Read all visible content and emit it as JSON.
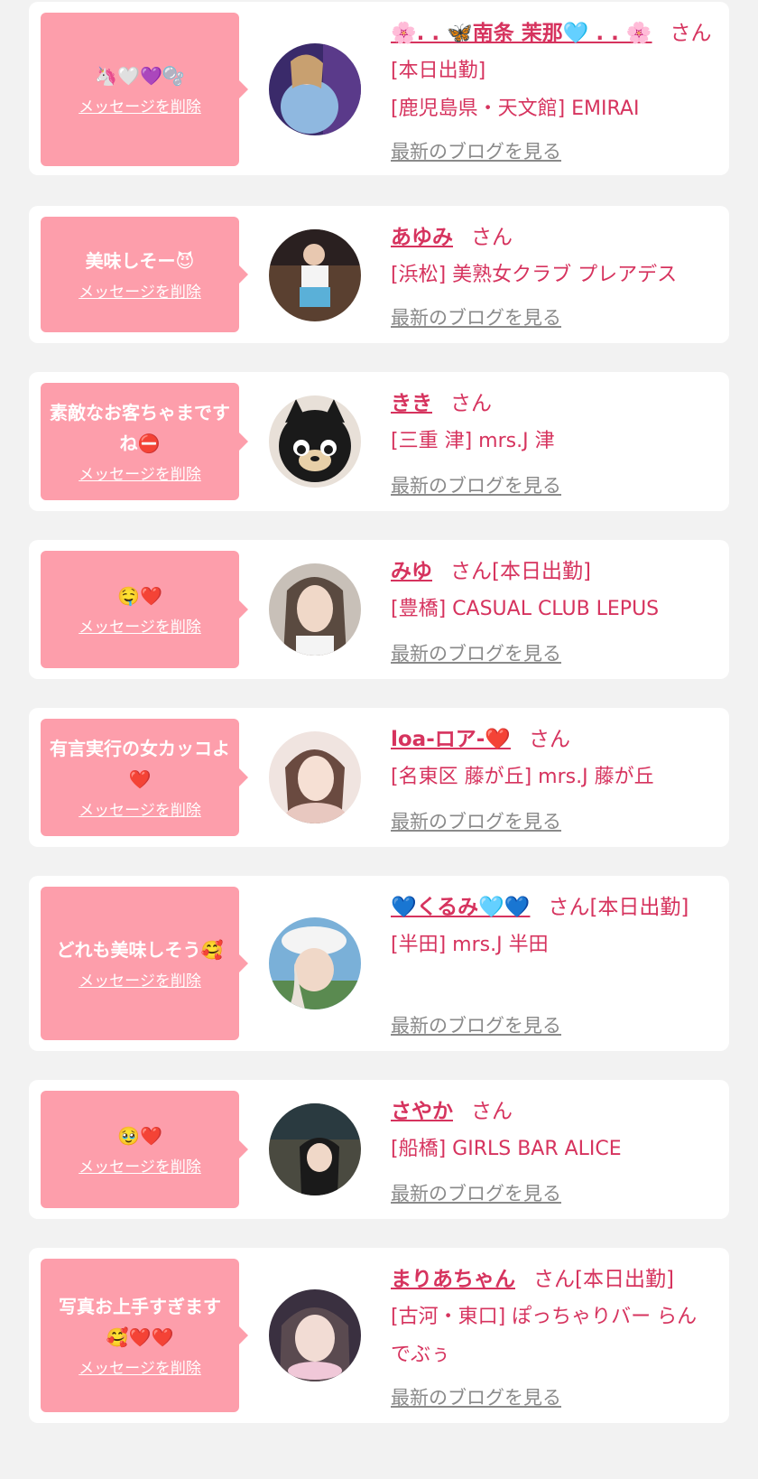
{
  "messages": [
    {
      "message": "🦄🤍💜🫧",
      "delete_label": "メッセージを削除",
      "name": "🌸. . 🦋南条 茉那🩵 . . 🌸",
      "suffix": "さん",
      "info": [
        "[本日出勤]",
        "[鹿児島県・天文館] EMIRAI"
      ],
      "blog_label": "最新のブログを見る"
    },
    {
      "message": "美味しそー😈",
      "delete_label": "メッセージを削除",
      "name": "あゆみ",
      "suffix": "さん",
      "info": [
        "[浜松] 美熟女クラブ プレアデス"
      ],
      "blog_label": "最新のブログを見る"
    },
    {
      "message": "素敵なお客ちゃまですね⛔",
      "delete_label": "メッセージを削除",
      "name": "きき",
      "suffix": "さん",
      "info": [
        "[三重 津] mrs.J 津"
      ],
      "blog_label": "最新のブログを見る"
    },
    {
      "message": "🤤❤️",
      "delete_label": "メッセージを削除",
      "name": "みゆ",
      "suffix": "さん[本日出勤]",
      "info": [
        "[豊橋] CASUAL CLUB LEPUS"
      ],
      "blog_label": "最新のブログを見る"
    },
    {
      "message": "有言実行の女カッコよ❤️",
      "delete_label": "メッセージを削除",
      "name": "loa-ロア-❤️",
      "suffix": "さん",
      "info": [
        "[名東区 藤が丘] mrs.J 藤が丘"
      ],
      "blog_label": "最新のブログを見る"
    },
    {
      "message": "どれも美味しそう🥰",
      "delete_label": "メッセージを削除",
      "name": "💙くるみ🩵💙",
      "suffix": "さん[本日出勤]",
      "info": [
        "[半田] mrs.J 半田"
      ],
      "blog_label": "最新のブログを見る"
    },
    {
      "message": "🥹❤️",
      "delete_label": "メッセージを削除",
      "name": "さやか",
      "suffix": "さん",
      "info": [
        "[船橋] GIRLS BAR ALICE"
      ],
      "blog_label": "最新のブログを見る"
    },
    {
      "message": "写真お上手すぎます🥰❤️❤️",
      "delete_label": "メッセージを削除",
      "name": "まりあちゃん",
      "suffix": "さん[本日出勤]",
      "info": [
        "[古河・東口] ぽっちゃりバー らんでぶぅ"
      ],
      "blog_label": "最新のブログを見る"
    }
  ],
  "colors": {
    "background": "#f2f2f2",
    "card": "#ffffff",
    "bubble": "#fd9eab",
    "accent": "#d6335e",
    "link_gray": "#8a8a8a"
  }
}
